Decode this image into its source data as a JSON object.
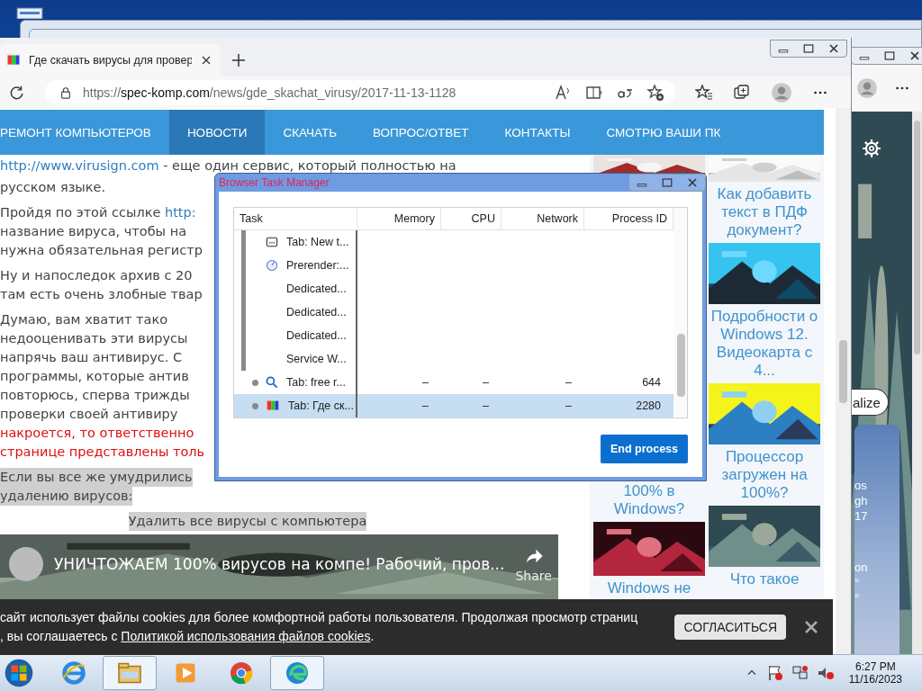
{
  "browser": {
    "tab": {
      "title": "Где скачать вирусы для провер"
    },
    "url": {
      "scheme": "https://",
      "domain": "spec-komp.com",
      "path": "/news/gde_skachat_virusy/2017-11-13-1128"
    },
    "nav": [
      {
        "label": "РЕМОНТ КОМПЬЮТЕРОВ",
        "selected": false
      },
      {
        "label": "НОВОСТИ",
        "selected": true
      },
      {
        "label": "СКАЧАТЬ",
        "selected": false
      },
      {
        "label": "ВОПРОС/ОТВЕТ",
        "selected": false
      },
      {
        "label": "КОНТАКТЫ",
        "selected": false
      },
      {
        "label": "СМОТРЮ ВАШИ ПК",
        "selected": false
      }
    ],
    "article": [
      {
        "lines": [
          {
            "kind": "plain",
            "parts": [
              {
                "kind": "link",
                "text": "http://www.virusign.com"
              },
              {
                "kind": "text",
                "text": " - еще один сервис, который полностью на"
              }
            ]
          },
          {
            "kind": "plain",
            "parts": [
              {
                "kind": "text",
                "text": "русском языке."
              }
            ]
          }
        ]
      },
      {
        "lines": [
          {
            "kind": "plain",
            "parts": [
              {
                "kind": "text",
                "text": "Пройдя по этой ссылке "
              },
              {
                "kind": "link",
                "text": "http:"
              }
            ]
          },
          {
            "kind": "plain",
            "parts": [
              {
                "kind": "text",
                "text": "название вируса, чтобы на"
              }
            ]
          },
          {
            "kind": "plain",
            "parts": [
              {
                "kind": "text",
                "text": "нужна обязательная регистр"
              }
            ]
          }
        ]
      },
      {
        "lines": [
          {
            "kind": "plain",
            "parts": [
              {
                "kind": "text",
                "text": "Ну и напоследок архив с 20"
              }
            ]
          },
          {
            "kind": "plain",
            "parts": [
              {
                "kind": "text",
                "text": "там есть очень злобные твар"
              }
            ]
          }
        ]
      },
      {
        "lines": [
          {
            "kind": "plain",
            "parts": [
              {
                "kind": "text",
                "text": "Думаю, вам хватит тако"
              }
            ]
          },
          {
            "kind": "plain",
            "parts": [
              {
                "kind": "text",
                "text": "недооценивать эти вирусы"
              }
            ]
          },
          {
            "kind": "plain",
            "parts": [
              {
                "kind": "text",
                "text": "напрячь ваш антивирус. С"
              }
            ]
          },
          {
            "kind": "plain",
            "parts": [
              {
                "kind": "text",
                "text": "программы, которые антив"
              }
            ]
          },
          {
            "kind": "plain",
            "parts": [
              {
                "kind": "text",
                "text": "повторюсь, сперва трижды"
              }
            ]
          },
          {
            "kind": "plain",
            "parts": [
              {
                "kind": "text",
                "text": "проверки своей антивиру"
              }
            ]
          },
          {
            "kind": "warning",
            "parts": [
              {
                "kind": "text",
                "text": "накроется, то ответственно"
              }
            ]
          },
          {
            "kind": "warning",
            "parts": [
              {
                "kind": "text",
                "text": "странице представлены толь"
              }
            ]
          }
        ]
      },
      {
        "lines": [
          {
            "kind": "highlight",
            "parts": [
              {
                "kind": "text",
                "text": "Если вы все же умудрились"
              }
            ]
          },
          {
            "kind": "highlight",
            "parts": [
              {
                "kind": "text",
                "text": "удалению вирусов:"
              }
            ]
          }
        ]
      },
      {
        "lines": [
          {
            "kind": "highlight_center",
            "parts": [
              {
                "kind": "text",
                "text": "Удалить все вирусы с компьютера"
              }
            ]
          }
        ]
      }
    ],
    "video": {
      "title": "УНИЧТОЖАЕМ 100% вирусов на компе! Рабочий, пров...",
      "share": "Share"
    },
    "sidebar": {
      "left": [
        {
          "kind": "picture"
        },
        {
          "kind": "link",
          "text": "100% в Windows?"
        },
        {
          "kind": "picture"
        },
        {
          "kind": "link",
          "text": "Windows не"
        }
      ],
      "right": [
        {
          "kind": "picture"
        },
        {
          "kind": "link",
          "text": "Как добавить текст в ПДФ документ?"
        },
        {
          "kind": "picture"
        },
        {
          "kind": "link",
          "text": "Подробности о Windows 12. Видеокарта с 4..."
        },
        {
          "kind": "picture"
        },
        {
          "kind": "link",
          "text": "Процессор загружен на 100%?"
        },
        {
          "kind": "picture"
        },
        {
          "kind": "link",
          "text": "Что такое"
        }
      ]
    },
    "cookie_bar": {
      "line_1": "сайт использует файлы cookies для более комфортной работы пользователя. Продолжая просмотр страниц",
      "line_2_before": ", вы соглашаетесь с ",
      "link": "Политикой использования файлов cookies",
      "line_2_after": ".",
      "button": "СОГЛАСИТЬСЯ"
    }
  },
  "side_window": {
    "button": "alize",
    "weather": [
      "os",
      "gh",
      "17",
      "on",
      "°",
      "°"
    ]
  },
  "task_manager": {
    "title": "Browser Task Manager",
    "columns": [
      "Task",
      "Memory",
      "CPU",
      "Network",
      "Process ID"
    ],
    "rows": [
      {
        "kind": "tab",
        "task": "Tab: New t...",
        "in_group": true,
        "dot": false,
        "selected": false
      },
      {
        "kind": "prerender",
        "task": "Prerender:...",
        "in_group": true,
        "dot": false,
        "selected": false
      },
      {
        "kind": "none",
        "task": "Dedicated...",
        "in_group": true,
        "dot": false,
        "selected": false
      },
      {
        "kind": "none",
        "task": "Dedicated...",
        "in_group": true,
        "dot": false,
        "selected": false
      },
      {
        "kind": "none",
        "task": "Dedicated...",
        "in_group": true,
        "dot": false,
        "selected": false
      },
      {
        "kind": "none",
        "task": "Service W...",
        "in_group": true,
        "dot": false,
        "selected": false
      },
      {
        "kind": "search",
        "task": "Tab: free r...",
        "in_group": false,
        "dot": true,
        "selected": false,
        "memory": "–",
        "cpu": "–",
        "network": "–",
        "process_id": "644"
      },
      {
        "kind": "favicon",
        "task": "Tab: Где ск...",
        "in_group": false,
        "dot": true,
        "selected": true,
        "memory": "–",
        "cpu": "–",
        "network": "–",
        "process_id": "2280"
      }
    ],
    "button": "End process"
  },
  "taskbar": {
    "apps": [
      {
        "kind": "ie",
        "active": false
      },
      {
        "kind": "explorer",
        "active": true
      },
      {
        "kind": "media",
        "active": false
      },
      {
        "kind": "chrome",
        "active": false
      },
      {
        "kind": "edge",
        "active": true
      }
    ],
    "time": "6:27 PM",
    "date": "11/16/2023"
  }
}
